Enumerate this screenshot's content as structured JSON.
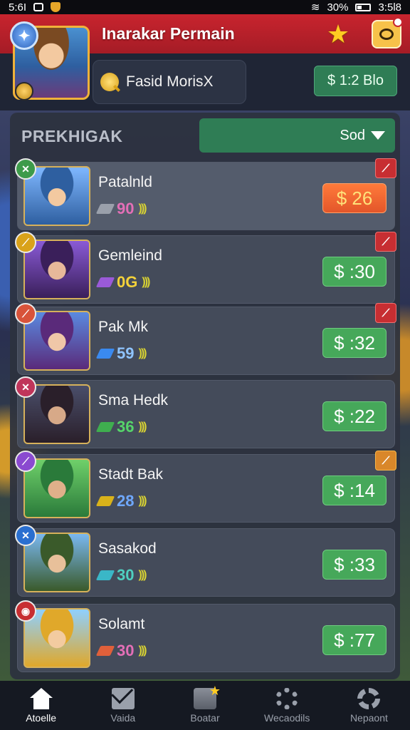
{
  "status_bar": {
    "left_text": "5:6I",
    "battery": "30%",
    "time": "3:5l8"
  },
  "header": {
    "title": "Inarakar Permain"
  },
  "profile": {
    "search_text": "Fasid MorisX",
    "balance": "$ 1:2 Blo"
  },
  "section": {
    "title": "PREKHIGAK",
    "sort_label": "Sod"
  },
  "rows": [
    {
      "name": "Patalnld",
      "stat": "90",
      "stat_color": "#e46fb7",
      "gem_color": "#9aa0ab",
      "price": "$ 26",
      "price_style": "orange",
      "badge_color": "#3d9b4a",
      "badge_symbol": "✕",
      "tag": "⟋",
      "tag_style": "red",
      "avatar_colors": [
        "#7fb7ff",
        "#2e5fa0",
        "#f3c9a0"
      ]
    },
    {
      "name": "Gemleind",
      "stat": "0G",
      "stat_color": "#f4d23a",
      "gem_color": "#9a5ad8",
      "price": "$ :30",
      "price_style": "green",
      "badge_color": "#d9a21a",
      "badge_symbol": "⟋",
      "tag": "⟋",
      "tag_style": "red",
      "avatar_colors": [
        "#8a5ad6",
        "#3a1f5a",
        "#e7b89a"
      ]
    },
    {
      "name": "Pak Mk",
      "stat": "59",
      "stat_color": "#8fc4ff",
      "gem_color": "#3a8af0",
      "price": "$ :32",
      "price_style": "green",
      "badge_color": "#d8533a",
      "badge_symbol": "⟋",
      "tag": "⟋",
      "tag_style": "red",
      "avatar_colors": [
        "#5a8ae0",
        "#5a2a7a",
        "#f0c7a8"
      ]
    },
    {
      "name": "Sma Hedk",
      "stat": "36",
      "stat_color": "#56d46a",
      "gem_color": "#3fae4f",
      "price": "$ :22",
      "price_style": "green",
      "badge_color": "#c0355a",
      "badge_symbol": "✕",
      "tag": "",
      "tag_style": "",
      "avatar_colors": [
        "#4a4e6a",
        "#2a1f2a",
        "#d7a988"
      ]
    },
    {
      "name": "Stadt Bak",
      "stat": "28",
      "stat_color": "#6fa8ff",
      "gem_color": "#d9b21a",
      "price": "$ :14",
      "price_style": "green",
      "badge_color": "#8a4ad0",
      "badge_symbol": "⟋",
      "tag": "⟋",
      "tag_style": "gold",
      "avatar_colors": [
        "#6fd06a",
        "#2a7a3a",
        "#e0b08a"
      ]
    },
    {
      "name": "Sasakod",
      "stat": "30",
      "stat_color": "#4fd0c0",
      "gem_color": "#3ab7c7",
      "price": "$ :33",
      "price_style": "green",
      "badge_color": "#2a6fd0",
      "badge_symbol": "✕",
      "tag": "",
      "tag_style": "",
      "avatar_colors": [
        "#7ab8f0",
        "#3a5a2a",
        "#e8c09a"
      ]
    },
    {
      "name": "Solamt",
      "stat": "30",
      "stat_color": "#e46fb7",
      "gem_color": "#e0603a",
      "price": "$ :77",
      "price_style": "green",
      "badge_color": "#c72e32",
      "badge_symbol": "◉",
      "tag": "",
      "tag_style": "",
      "avatar_colors": [
        "#8fd0ff",
        "#e0a82a",
        "#f3cba0"
      ]
    }
  ],
  "nav": [
    {
      "label": "Atoelle",
      "icon": "home-icon",
      "active": true
    },
    {
      "label": "Vaida",
      "icon": "mail-icon",
      "active": false
    },
    {
      "label": "Boatar",
      "icon": "toolbox-icon",
      "active": false
    },
    {
      "label": "Wecaodils",
      "icon": "gear-icon",
      "active": false
    },
    {
      "label": "Nepaont",
      "icon": "gears-icon",
      "active": false
    }
  ]
}
